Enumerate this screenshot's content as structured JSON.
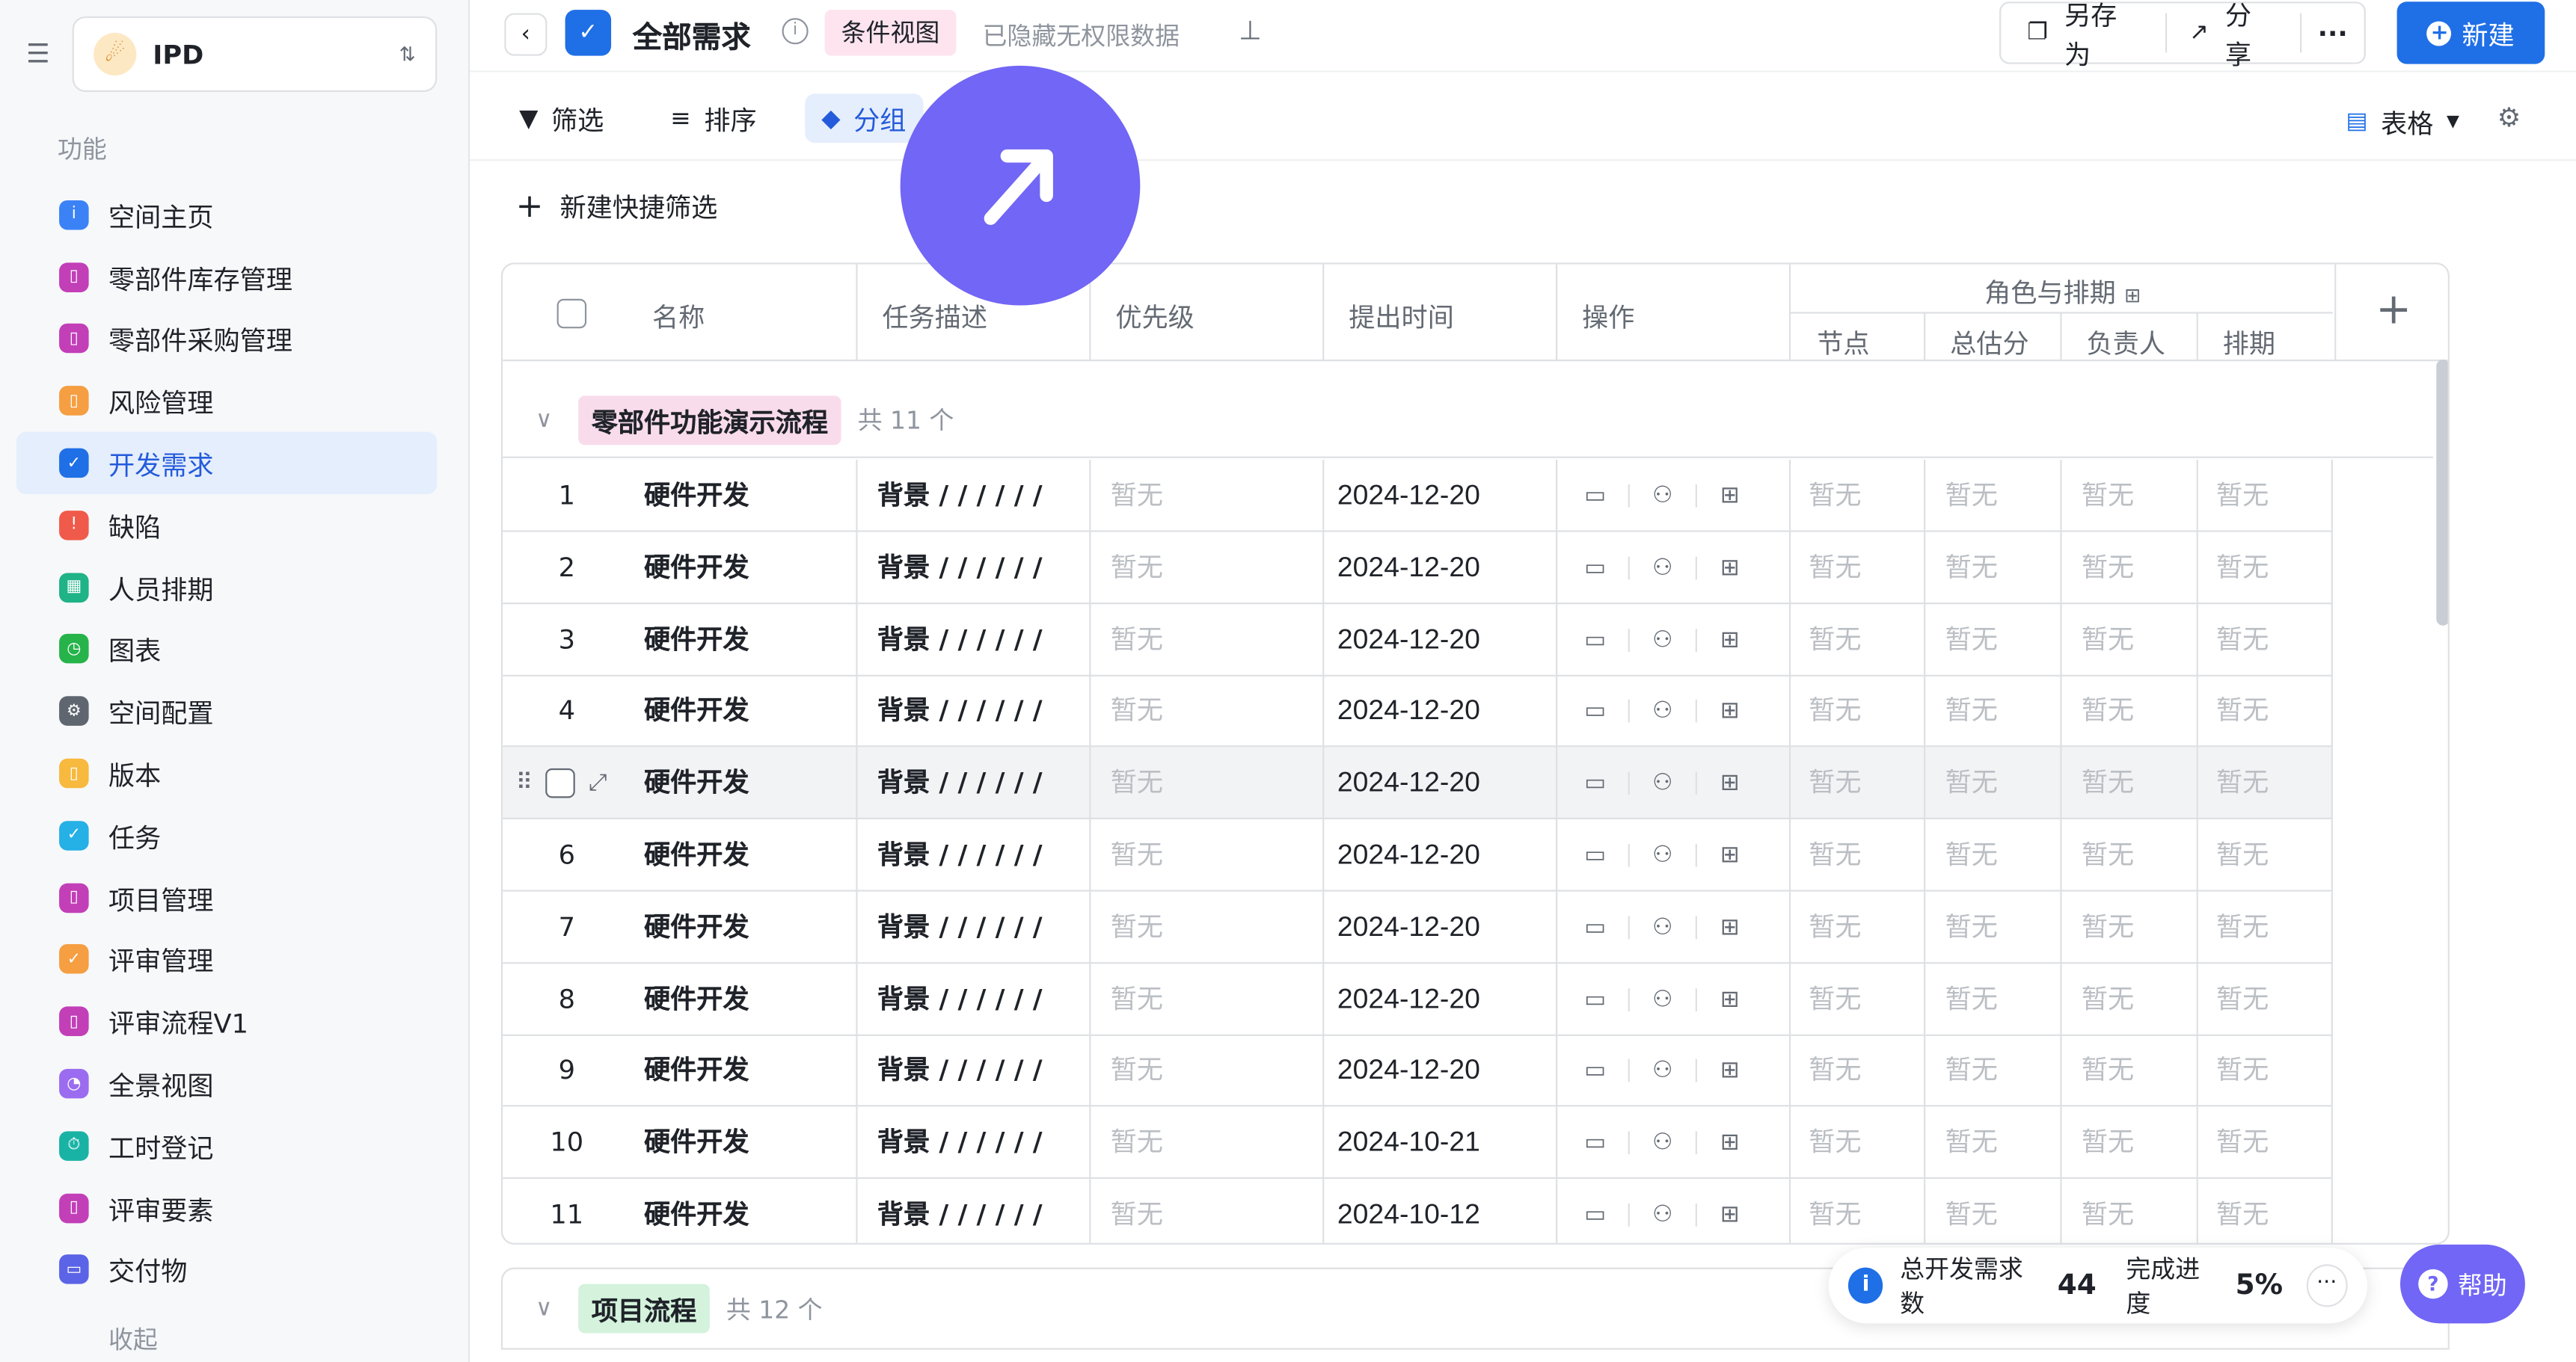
{
  "space": {
    "name": "IPD"
  },
  "sidebar": {
    "section_label": "功能",
    "collapse_label": "收起",
    "items": [
      {
        "label": "空间主页",
        "icon": "info-icon",
        "color": "#3b82f6"
      },
      {
        "label": "零部件库存管理",
        "icon": "bookmark-icon",
        "color": "#c23fb8"
      },
      {
        "label": "零部件采购管理",
        "icon": "bookmark-icon",
        "color": "#c23fb8"
      },
      {
        "label": "风险管理",
        "icon": "bookmark-icon",
        "color": "#f59e42"
      },
      {
        "label": "开发需求",
        "icon": "check-circle-icon",
        "color": "#1f6fe6",
        "active": true
      },
      {
        "label": "缺陷",
        "icon": "alert-icon",
        "color": "#f05a4a"
      },
      {
        "label": "人员排期",
        "icon": "table-icon",
        "color": "#1fb387"
      },
      {
        "label": "图表",
        "icon": "clock-icon",
        "color": "#26b34a"
      },
      {
        "label": "空间配置",
        "icon": "gear-icon",
        "color": "#5f6670"
      },
      {
        "label": "版本",
        "icon": "bookmark-icon",
        "color": "#f7b93e"
      },
      {
        "label": "任务",
        "icon": "check-circle-icon",
        "color": "#25b0e6"
      },
      {
        "label": "项目管理",
        "icon": "bookmark-icon",
        "color": "#c23fb8"
      },
      {
        "label": "评审管理",
        "icon": "check-circle-icon",
        "color": "#f59e42"
      },
      {
        "label": "评审流程V1",
        "icon": "bookmark-icon",
        "color": "#c23fb8"
      },
      {
        "label": "全景视图",
        "icon": "chart-icon",
        "color": "#9b6cf0"
      },
      {
        "label": "工时登记",
        "icon": "timer-icon",
        "color": "#19b3a6"
      },
      {
        "label": "评审要素",
        "icon": "bookmark-icon",
        "color": "#c23fb8"
      },
      {
        "label": "交付物",
        "icon": "box-icon",
        "color": "#5b63e6"
      }
    ]
  },
  "header": {
    "title": "全部需求",
    "view_tag": "条件视图",
    "hidden_note": "已隐藏无权限数据",
    "save_as": "另存为",
    "share": "分享",
    "more": "···",
    "new": "新建"
  },
  "toolbar": {
    "filter": "筛选",
    "sort": "排序",
    "group": "分组",
    "view_mode": "表格",
    "quick_filter": "新建快捷筛选"
  },
  "table": {
    "columns": {
      "name": "名称",
      "desc": "任务描述",
      "priority": "优先级",
      "date": "提出时间",
      "ops": "操作",
      "role_group": "角色与排期",
      "node": "节点",
      "estimate": "总估分",
      "owner": "负责人",
      "schedule": "排期"
    },
    "groups": [
      {
        "name": "零部件功能演示流程",
        "count": "共 11 个",
        "color": "#f9dcec"
      },
      {
        "name": "项目流程",
        "count": "共 12 个",
        "color": "#d4f2dc"
      }
    ],
    "empty_text": "暂无",
    "rows": [
      {
        "idx": "1",
        "name": "硬件开发",
        "desc": "背景 / / / / / /",
        "date": "2024-12-20"
      },
      {
        "idx": "2",
        "name": "硬件开发",
        "desc": "背景 / / / / / /",
        "date": "2024-12-20"
      },
      {
        "idx": "3",
        "name": "硬件开发",
        "desc": "背景 / / / / / /",
        "date": "2024-12-20"
      },
      {
        "idx": "4",
        "name": "硬件开发",
        "desc": "背景 / / / / / /",
        "date": "2024-12-20"
      },
      {
        "idx": "",
        "name": "硬件开发",
        "desc": "背景 / / / / / /",
        "date": "2024-12-20",
        "hover": true
      },
      {
        "idx": "6",
        "name": "硬件开发",
        "desc": "背景 / / / / / /",
        "date": "2024-12-20"
      },
      {
        "idx": "7",
        "name": "硬件开发",
        "desc": "背景 / / / / / /",
        "date": "2024-12-20"
      },
      {
        "idx": "8",
        "name": "硬件开发",
        "desc": "背景 / / / / / /",
        "date": "2024-12-20"
      },
      {
        "idx": "9",
        "name": "硬件开发",
        "desc": "背景 / / / / / /",
        "date": "2024-12-20"
      },
      {
        "idx": "10",
        "name": "硬件开发",
        "desc": "背景 / / / / / /",
        "date": "2024-10-21"
      },
      {
        "idx": "11",
        "name": "硬件开发",
        "desc": "背景 / / / / / /",
        "date": "2024-10-12"
      }
    ]
  },
  "stats": {
    "total_label": "总开发需求数",
    "total_value": "44",
    "progress_label": "完成进度",
    "progress_value": "5%"
  },
  "help": {
    "label": "帮助"
  }
}
